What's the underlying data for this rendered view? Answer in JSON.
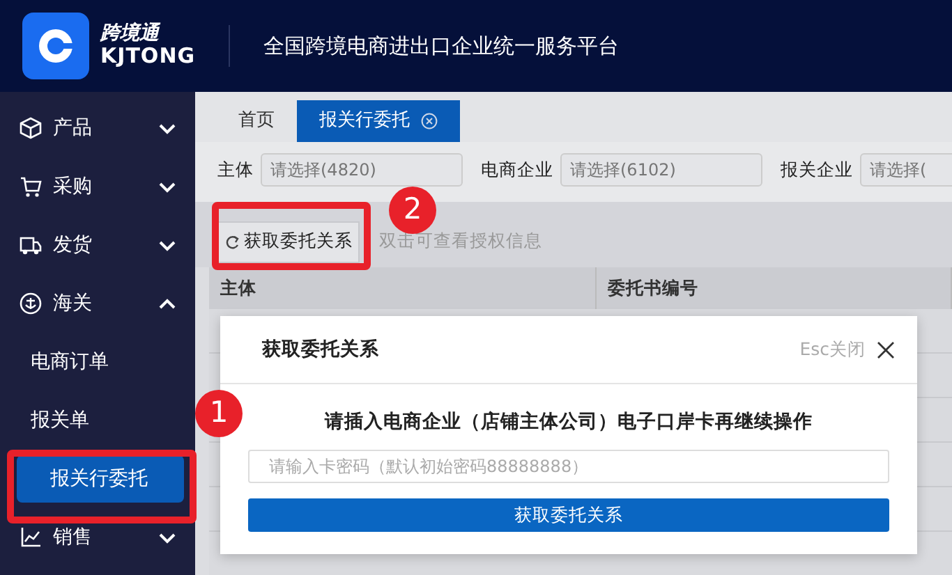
{
  "header": {
    "logo_name": "跨境通",
    "logo_latin": "KJTONG",
    "title": "全国跨境电商进出口企业统一服务平台"
  },
  "sidebar": {
    "items": [
      {
        "label": "产品",
        "expanded": false
      },
      {
        "label": "采购",
        "expanded": false
      },
      {
        "label": "发货",
        "expanded": false
      },
      {
        "label": "海关",
        "expanded": true,
        "children": [
          {
            "label": "电商订单",
            "selected": false
          },
          {
            "label": "报关单",
            "selected": false
          },
          {
            "label": "报关行委托",
            "selected": true
          }
        ]
      },
      {
        "label": "销售",
        "expanded": false
      }
    ]
  },
  "tabs": [
    {
      "label": "首页",
      "selected": false,
      "closable": false
    },
    {
      "label": "报关行委托",
      "selected": true,
      "closable": true
    }
  ],
  "filters": [
    {
      "label": "主体",
      "placeholder": "请选择(4820)"
    },
    {
      "label": "电商企业",
      "placeholder": "请选择(6102)"
    },
    {
      "label": "报关企业",
      "placeholder": "请选择("
    }
  ],
  "toolbar": {
    "button": "获取委托关系",
    "hint": "双击可查看授权信息"
  },
  "table": {
    "columns": [
      "主体",
      "委托书编号"
    ]
  },
  "modal": {
    "title": "获取委托关系",
    "esc_hint": "Esc关闭",
    "message": "请插入电商企业（店铺主体公司）电子口岸卡再继续操作",
    "password_placeholder": "请输入卡密码（默认初始密码88888888）",
    "submit": "获取委托关系"
  },
  "annotations": [
    {
      "label": "1"
    },
    {
      "label": "2"
    }
  ]
}
